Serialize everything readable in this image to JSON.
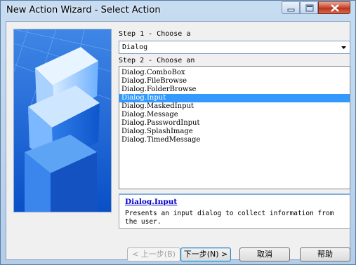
{
  "window": {
    "title": "New Action Wizard - Select Action"
  },
  "step1": {
    "label": "Step 1 - Choose a",
    "category_value": "Dialog"
  },
  "step2": {
    "label": "Step 2 - Choose an",
    "actions": [
      "Dialog.ComboBox",
      "Dialog.FileBrowse",
      "Dialog.FolderBrowse",
      "Dialog.Input",
      "Dialog.MaskedInput",
      "Dialog.Message",
      "Dialog.PasswordInput",
      "Dialog.SplashImage",
      "Dialog.TimedMessage"
    ],
    "selected": "Dialog.Input"
  },
  "description": {
    "title": "Dialog.Input",
    "text": "Presents an input dialog to collect information from the user."
  },
  "buttons": {
    "back": "< 上一步(B)",
    "next": "下一步(N) >",
    "cancel": "取消",
    "help": "帮助"
  },
  "colors": {
    "selection": "#3399ff",
    "link": "#0000cc"
  }
}
